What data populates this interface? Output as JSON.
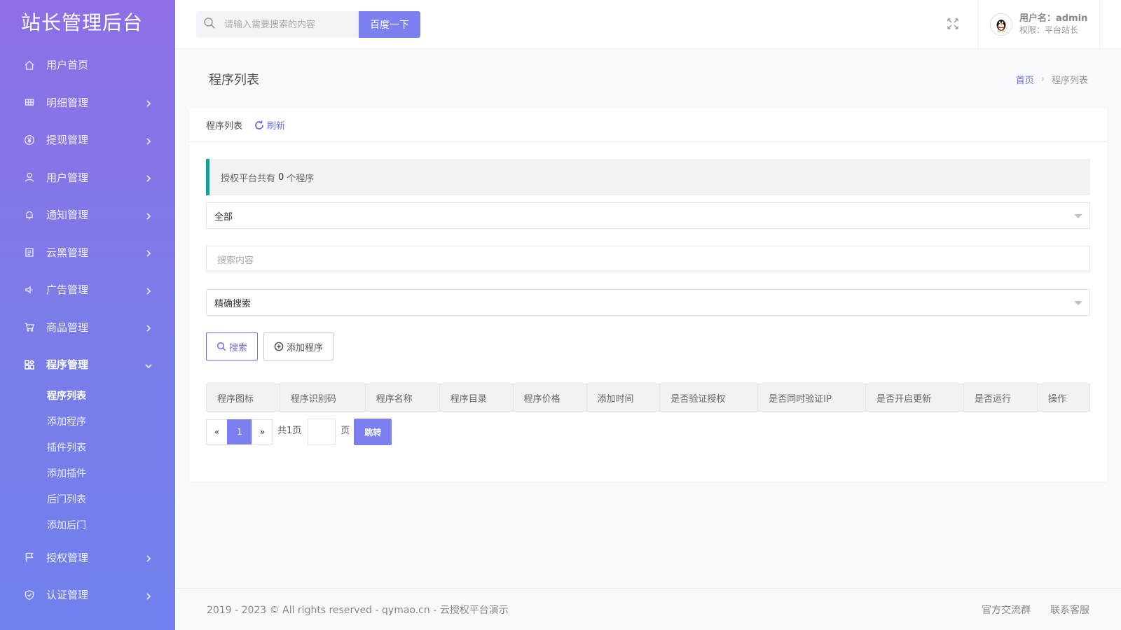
{
  "sidebar": {
    "logo": "站长管理后台",
    "items": [
      {
        "label": "用户首页",
        "icon": "home-icon",
        "has_arrow": false
      },
      {
        "label": "明细管理",
        "icon": "table-icon",
        "has_arrow": true
      },
      {
        "label": "提现管理",
        "icon": "yen-icon",
        "has_arrow": true
      },
      {
        "label": "用户管理",
        "icon": "user-icon",
        "has_arrow": true
      },
      {
        "label": "通知管理",
        "icon": "bell-icon",
        "has_arrow": true
      },
      {
        "label": "云黑管理",
        "icon": "clipboard-icon",
        "has_arrow": true
      },
      {
        "label": "广告管理",
        "icon": "speaker-icon",
        "has_arrow": true
      },
      {
        "label": "商品管理",
        "icon": "cart-icon",
        "has_arrow": true
      },
      {
        "label": "程序管理",
        "icon": "apps-icon",
        "has_arrow": true,
        "expanded": true
      }
    ],
    "sub_items": [
      "程序列表",
      "添加程序",
      "插件列表",
      "添加插件",
      "后门列表",
      "添加后门"
    ],
    "items_after": [
      {
        "label": "授权管理",
        "icon": "flag-icon"
      },
      {
        "label": "认证管理",
        "icon": "shield-icon"
      }
    ]
  },
  "header": {
    "search_placeholder": "请输入需要搜索的内容",
    "search_button": "百度一下",
    "username_label": "用户名：admin",
    "role_label": "权限：平台站长"
  },
  "page": {
    "title": "程序列表",
    "breadcrumb_home": "首页",
    "breadcrumb_sep": "›",
    "breadcrumb_current": "程序列表"
  },
  "card": {
    "head_title": "程序列表",
    "refresh_label": "刷新",
    "notice_prefix": "授权平台共有",
    "notice_count": "0",
    "notice_suffix": "个程序",
    "filter_select": "全部",
    "search_placeholder": "搜索内容",
    "mode_select": "精确搜索",
    "search_button": "搜索",
    "add_button": "添加程序",
    "table_headers": [
      "程序图标",
      "程序识别码",
      "程序名称",
      "程序目录",
      "程序价格",
      "添加时间",
      "是否验证授权",
      "是否同时验证IP",
      "是否开启更新",
      "是否运行",
      "操作"
    ],
    "pager": {
      "prev": "«",
      "current": "1",
      "next": "»",
      "total": "共1页",
      "unit": "页",
      "go": "跳转"
    }
  },
  "footer": {
    "copyright": "2019 - 2023 © All rights reserved - qymao.cn - 云授权平台演示",
    "link1": "官方交流群",
    "link2": "联系客服"
  },
  "colors": {
    "accent": "#7b7ff0",
    "sidebar_top": "#8e6fe6",
    "sidebar_bottom": "#7080ee",
    "notice_border": "#1aa094"
  }
}
